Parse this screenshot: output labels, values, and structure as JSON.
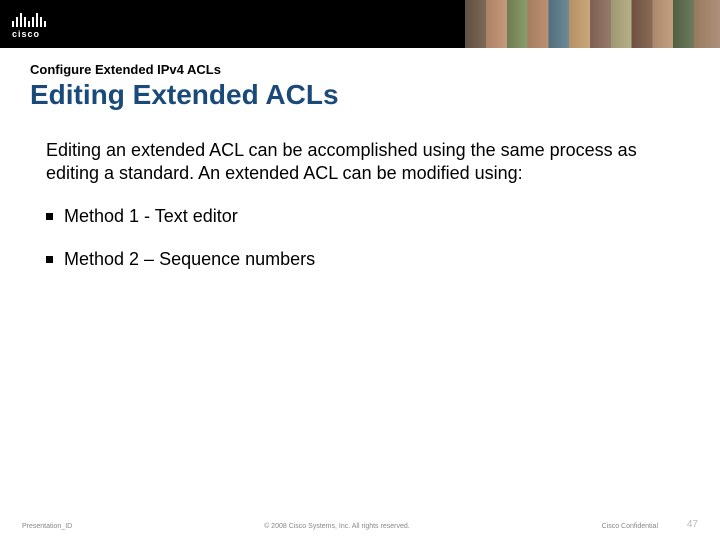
{
  "header": {
    "logo_word": "cisco"
  },
  "content": {
    "pre_title": "Configure Extended IPv4 ACLs",
    "main_title": "Editing Extended ACLs",
    "paragraph": "Editing an extended ACL can be accomplished using the same process as editing a standard. An extended ACL can be modified using:",
    "bullets": [
      "Method 1 - Text editor",
      "Method 2 – Sequence numbers"
    ]
  },
  "footer": {
    "left": "Presentation_ID",
    "center": "© 2008 Cisco Systems, Inc. All rights reserved.",
    "right": "Cisco Confidential",
    "page": "47"
  }
}
